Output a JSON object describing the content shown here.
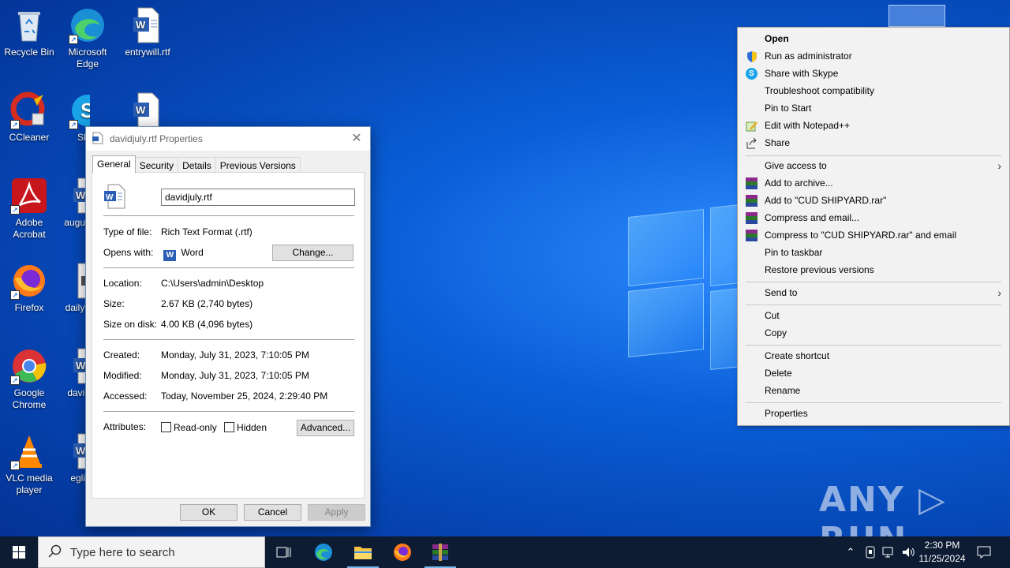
{
  "desktop": {
    "icons": [
      {
        "label": "Recycle Bin"
      },
      {
        "label": "Microsoft Edge"
      },
      {
        "label": "entrywill.rtf"
      },
      {
        "label": "CCleaner"
      },
      {
        "label": "Sk"
      },
      {
        "label": "Adobe Acrobat"
      },
      {
        "label": "augus"
      },
      {
        "label": "Firefox"
      },
      {
        "label": "dailye"
      },
      {
        "label": "Google Chrome"
      },
      {
        "label": "david"
      },
      {
        "label": "VLC media player"
      },
      {
        "label": "egliv"
      }
    ]
  },
  "dialog": {
    "title": "davidjuly.rtf Properties",
    "close_glyph": "✕",
    "tabs": [
      "General",
      "Security",
      "Details",
      "Previous Versions"
    ],
    "filename_value": "davidjuly.rtf",
    "type_label": "Type of file:",
    "type_value": "Rich Text Format (.rtf)",
    "opens_label": "Opens with:",
    "opens_value": "Word",
    "change_btn": "Change...",
    "location_label": "Location:",
    "location_value": "C:\\Users\\admin\\Desktop",
    "size_label": "Size:",
    "size_value": "2.67 KB (2,740 bytes)",
    "disk_label": "Size on disk:",
    "disk_value": "4.00 KB (4,096 bytes)",
    "created_label": "Created:",
    "created_value": "Monday, July 31, 2023, 7:10:05 PM",
    "modified_label": "Modified:",
    "modified_value": "Monday, July 31, 2023, 7:10:05 PM",
    "accessed_label": "Accessed:",
    "accessed_value": "Today, November 25, 2024, 2:29:40 PM",
    "attributes_label": "Attributes:",
    "readonly_label": "Read-only",
    "hidden_label": "Hidden",
    "advanced_btn": "Advanced...",
    "ok_btn": "OK",
    "cancel_btn": "Cancel",
    "apply_btn": "Apply"
  },
  "context_menu": {
    "items": [
      {
        "label": "Open"
      },
      {
        "label": "Run as administrator"
      },
      {
        "label": "Share with Skype"
      },
      {
        "label": "Troubleshoot compatibility"
      },
      {
        "label": "Pin to Start"
      },
      {
        "label": "Edit with Notepad++"
      },
      {
        "label": "Share"
      },
      {
        "label": "Give access to"
      },
      {
        "label": "Add to archive..."
      },
      {
        "label": "Add to \"CUD SHIPYARD.rar\""
      },
      {
        "label": "Compress and email..."
      },
      {
        "label": "Compress to \"CUD SHIPYARD.rar\" and email"
      },
      {
        "label": "Pin to taskbar"
      },
      {
        "label": "Restore previous versions"
      },
      {
        "label": "Send to"
      },
      {
        "label": "Cut"
      },
      {
        "label": "Copy"
      },
      {
        "label": "Create shortcut"
      },
      {
        "label": "Delete"
      },
      {
        "label": "Rename"
      },
      {
        "label": "Properties"
      }
    ]
  },
  "taskbar": {
    "search_placeholder": "Type here to search",
    "time": "2:30 PM",
    "date": "11/25/2024"
  },
  "watermark": "ANY ▷ RUN",
  "colors": {
    "taskbar": "#0d1b33",
    "wallpaper": "#0a5fd8",
    "accent": "#76b9ed"
  }
}
